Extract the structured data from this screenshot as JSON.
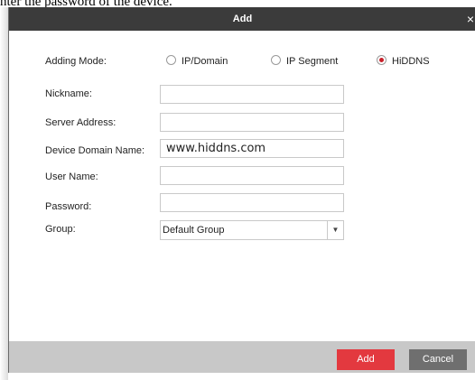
{
  "doc_text": "nter the password of the device.",
  "dialog": {
    "title": "Add",
    "close_glyph": "×"
  },
  "adding_mode": {
    "label": "Adding Mode:",
    "options": [
      "IP/Domain",
      "IP Segment",
      "HiDDNS"
    ],
    "selected": "HiDDNS"
  },
  "form": {
    "nickname_label": "Nickname:",
    "nickname_value": "",
    "server_label": "Server Address:",
    "server_value": "",
    "domain_label": "Device Domain Name:",
    "domain_value": "www.hiddns.com",
    "user_label": "User Name:",
    "user_value": "",
    "password_label": "Password:",
    "password_value": "",
    "group_label": "Group:",
    "group_value": "Default Group"
  },
  "buttons": {
    "add": "Add",
    "cancel": "Cancel"
  },
  "colors": {
    "titlebar": "#3b3b3b",
    "accent_red": "#e3393f",
    "cancel_gray": "#6f6f6f",
    "footer_gray": "#c8c8c8"
  },
  "icons": {
    "close": "close-icon",
    "dropdown": "chevron-down-icon"
  }
}
